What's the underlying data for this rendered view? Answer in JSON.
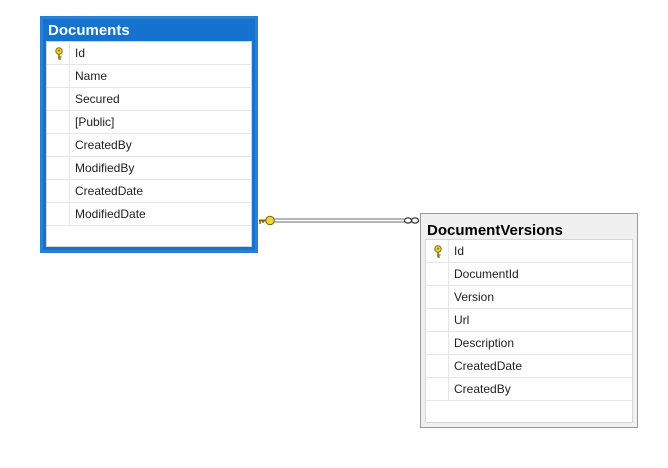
{
  "documents": {
    "title": "Documents",
    "columns": [
      "Id",
      "Name",
      "Secured",
      "[Public]",
      "CreatedBy",
      "ModifiedBy",
      "CreatedDate",
      "ModifiedDate"
    ],
    "primary_key": "Id",
    "header_color": "#1573cf"
  },
  "document_versions": {
    "title": "DocumentVersions",
    "columns": [
      "Id",
      "DocumentId",
      "Version",
      "Url",
      "Description",
      "CreatedDate",
      "CreatedBy"
    ],
    "primary_key": "Id"
  },
  "relationship": {
    "from": "Documents",
    "to": "DocumentVersions",
    "from_end": "key-icon",
    "to_end": "infinity-icon"
  }
}
